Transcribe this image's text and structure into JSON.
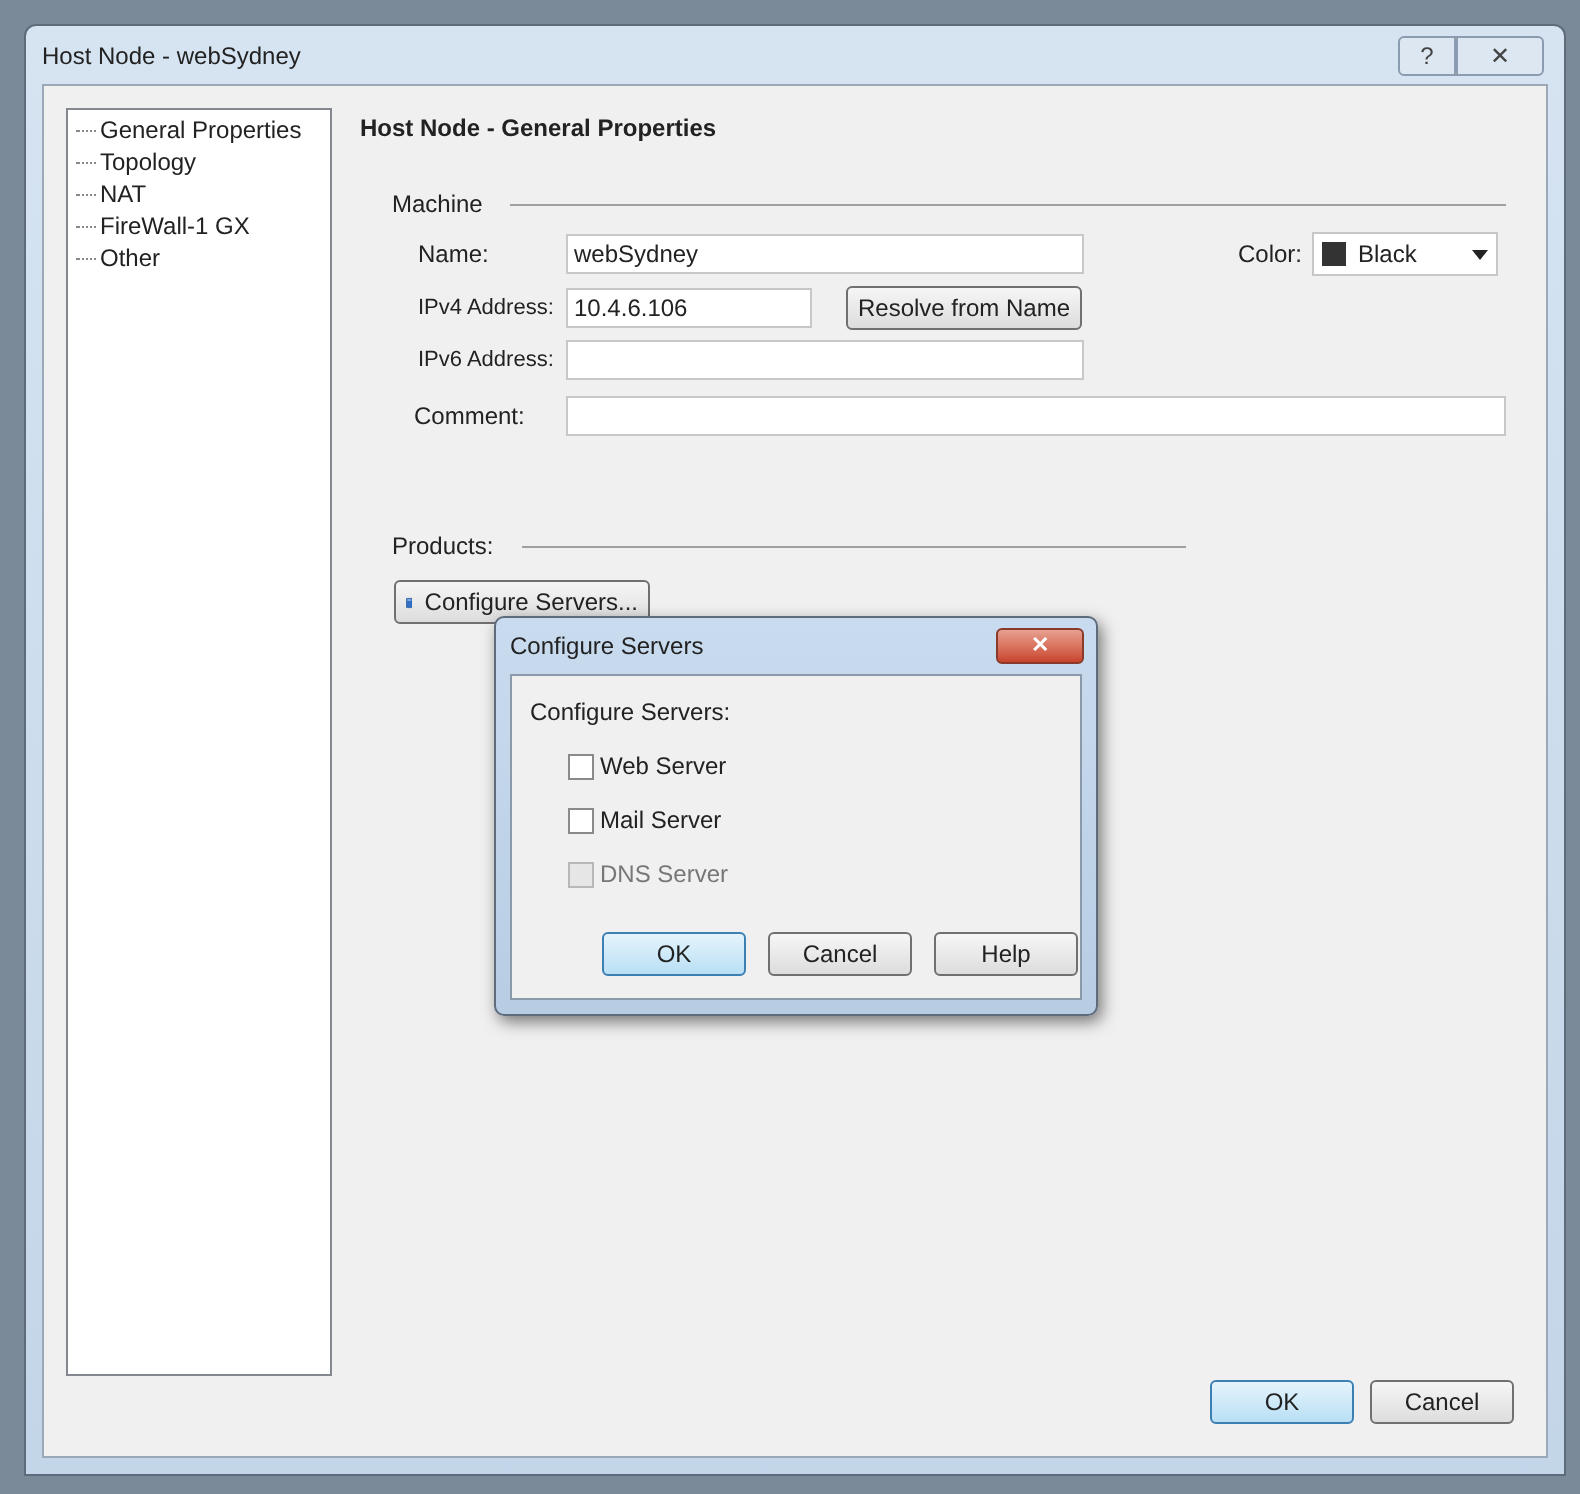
{
  "window": {
    "title": "Host Node - webSydney",
    "buttons": [
      "?",
      "✕"
    ]
  },
  "tree": {
    "items": [
      {
        "label": "General Properties"
      },
      {
        "label": "Topology"
      },
      {
        "label": "NAT"
      },
      {
        "label": "FireWall-1 GX"
      },
      {
        "label": "Other"
      }
    ]
  },
  "page": {
    "heading": "Host Node - General Properties",
    "machine": {
      "title": "Machine",
      "name_label": "Name:",
      "name_value": "webSydney",
      "color_label": "Color:",
      "color": {
        "label": "Black",
        "color": "#333333"
      },
      "ipv4_label": "IPv4 Address:",
      "ipv4_value": "10.4.6.106",
      "resolve_button": "Resolve from Name",
      "ipv6_label": "IPv6 Address:",
      "comment_label": "Comment:"
    },
    "products": {
      "title": "Products:",
      "configure_button": "Configure Servers..."
    }
  },
  "dialog": {
    "title": "Configure Servers",
    "close": "✕",
    "label": "Configure Servers:",
    "options": [
      {
        "label": "Web Server",
        "checked": false,
        "disabled": false
      },
      {
        "label": "Mail Server",
        "checked": false,
        "disabled": false
      },
      {
        "label": "DNS Server",
        "checked": false,
        "disabled": true
      }
    ],
    "buttons": [
      {
        "label": "OK",
        "default": true
      },
      {
        "label": "Cancel",
        "default": false
      },
      {
        "label": "Help",
        "default": false
      }
    ]
  },
  "buttons": [
    {
      "label": "OK",
      "default": true
    },
    {
      "label": "Cancel",
      "default": false
    }
  ]
}
